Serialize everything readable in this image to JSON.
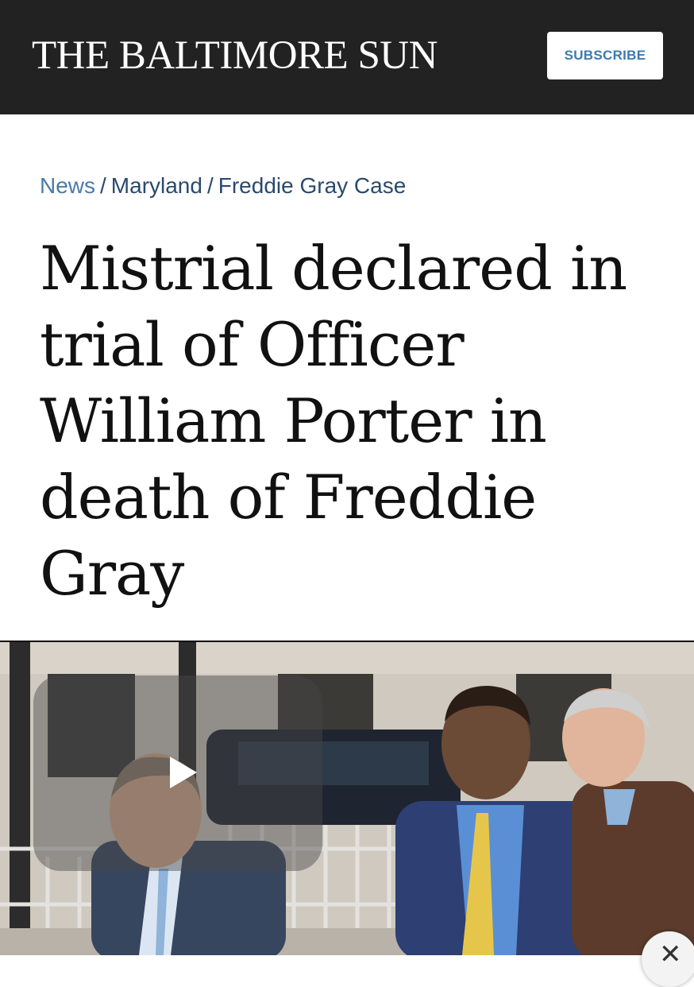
{
  "header": {
    "masthead": "THE BALTIMORE SUN",
    "subscribe_label": "SUBSCRIBE"
  },
  "breadcrumb": {
    "items": [
      "News",
      "Maryland",
      "Freddie Gray Case"
    ],
    "separator": "/"
  },
  "article": {
    "headline": "Mistrial declared in trial of Officer William Porter in death of Freddie Gray"
  },
  "video": {
    "play_icon": "play-icon",
    "close_icon": "close-icon"
  },
  "colors": {
    "header_bg": "#222222",
    "subscribe_text": "#3b7bb0",
    "breadcrumb_link": "#4a7aa8",
    "breadcrumb_text": "#2a4a6e",
    "headline": "#111111"
  }
}
